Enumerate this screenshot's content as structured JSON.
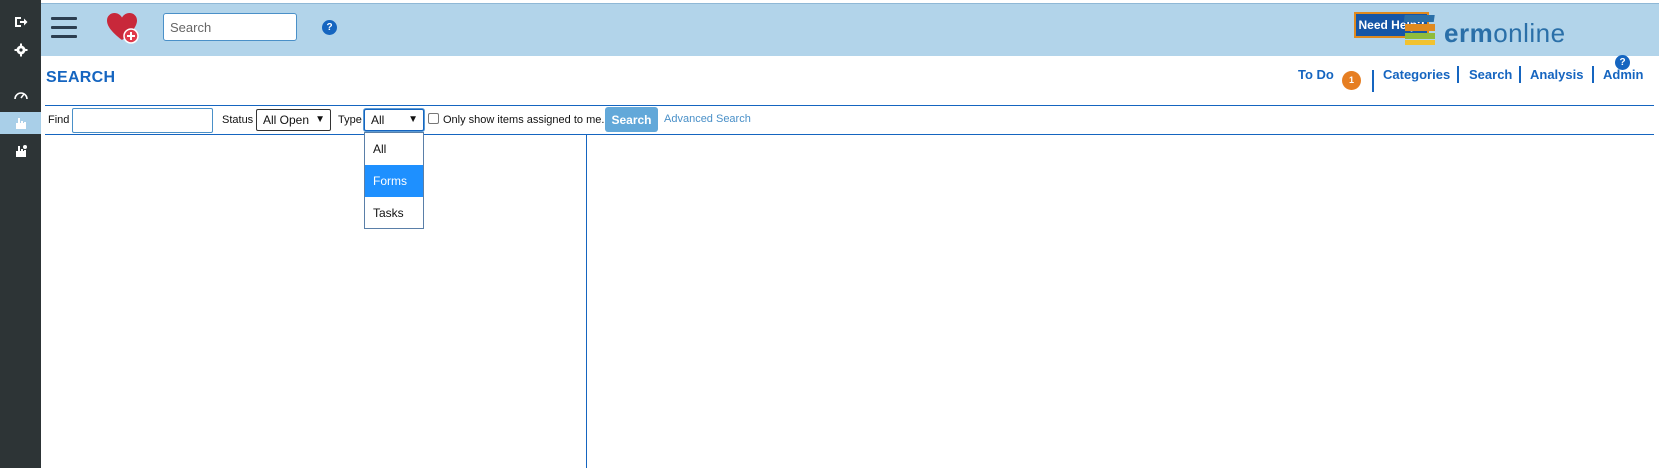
{
  "topbar": {
    "search_placeholder": "Search",
    "help_icon": "?",
    "need_help_label": "Need Help?",
    "logo": {
      "brand_part1": "erm",
      "brand_part2": "online"
    }
  },
  "header": {
    "title": "SEARCH",
    "help_icon": "?",
    "nav": {
      "todo_label": "To Do",
      "todo_count": "1",
      "categories_label": "Categories",
      "search_label": "Search",
      "analysis_label": "Analysis",
      "admin_label": "Admin"
    }
  },
  "filters": {
    "find_label": "Find",
    "find_value": "",
    "status_label": "Status",
    "status_value": "All Open",
    "type_label": "Type",
    "type_value": "All",
    "type_options": [
      "All",
      "Forms",
      "Tasks"
    ],
    "type_highlighted": "Forms",
    "assigned_label": "Only show items assigned to me.",
    "assigned_checked": false,
    "search_button": "Search",
    "advanced_link": "Advanced Search"
  },
  "colors": {
    "topbar": "#b2d4ea",
    "rail": "#2d3436",
    "accent": "#1565c0",
    "badge": "#e67e22",
    "need_help_bg": "#1656a6",
    "dropdown_highlight": "#1e90ff"
  },
  "icons": {
    "rail": [
      "logout-icon",
      "gear-icon",
      "dashboard-icon",
      "hand-pointer-icon",
      "hand-pointer-alt-icon"
    ]
  }
}
